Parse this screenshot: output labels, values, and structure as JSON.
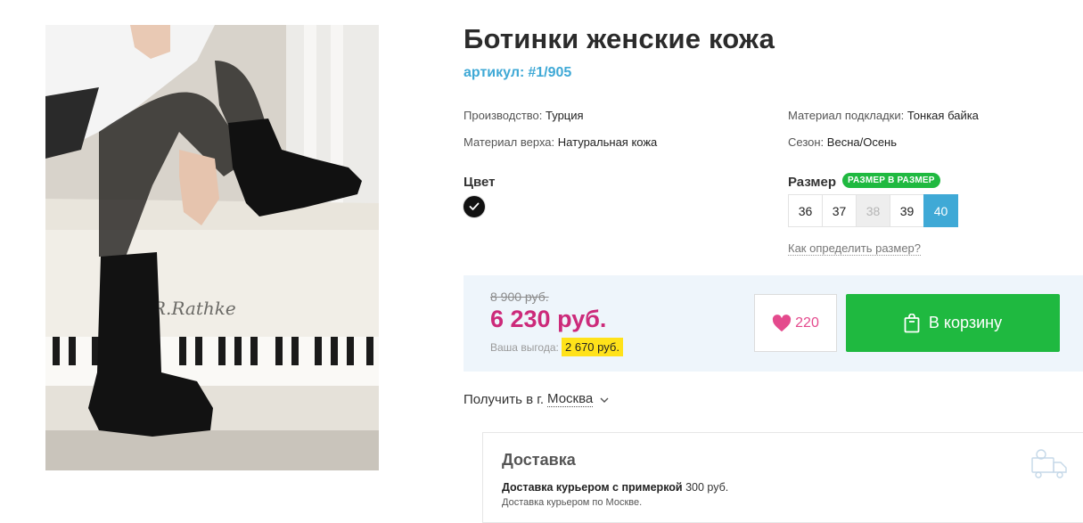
{
  "product": {
    "title": "Ботинки женские кожа",
    "sku_label": "артикул:",
    "sku_value": "#1/905"
  },
  "attributes": {
    "production_label": "Производство:",
    "production_value": "Турция",
    "upper_label": "Материал верха:",
    "upper_value": "Натуральная кожа",
    "lining_label": "Материал подкладки:",
    "lining_value": "Тонкая байка",
    "season_label": "Сезон:",
    "season_value": "Весна/Осень"
  },
  "color": {
    "label": "Цвет",
    "selected": "black",
    "swatch_color": "#111111"
  },
  "size": {
    "label": "Размер",
    "badge": "РАЗМЕР В РАЗМЕР",
    "options": [
      {
        "value": "36",
        "state": "available"
      },
      {
        "value": "37",
        "state": "available"
      },
      {
        "value": "38",
        "state": "unavailable"
      },
      {
        "value": "39",
        "state": "available"
      },
      {
        "value": "40",
        "state": "selected"
      }
    ],
    "help_link": "Как определить размер?"
  },
  "price": {
    "old": "8 900 руб.",
    "current": "6 230 руб.",
    "benefit_label": "Ваша выгода:",
    "benefit_value": "2 670 руб."
  },
  "actions": {
    "favorites_count": "220",
    "cart_label": "В корзину"
  },
  "pickup": {
    "label": "Получить в г.",
    "city": "Москва"
  },
  "delivery": {
    "title": "Доставка",
    "courier_bold": "Доставка курьером с примеркой",
    "courier_price": "300 руб.",
    "courier_note": "Доставка курьером по Москве."
  },
  "icons": {
    "heart": "heart-icon",
    "bag": "shopping-bag-icon",
    "chevron": "chevron-down-icon",
    "check": "check-icon",
    "truck": "delivery-truck-icon"
  },
  "colors": {
    "accent_blue": "#3fa9d6",
    "price_pink": "#cc2a7a",
    "cart_green": "#1fb940",
    "benefit_yellow": "#ffe21a",
    "price_bg": "#eef5fb"
  }
}
